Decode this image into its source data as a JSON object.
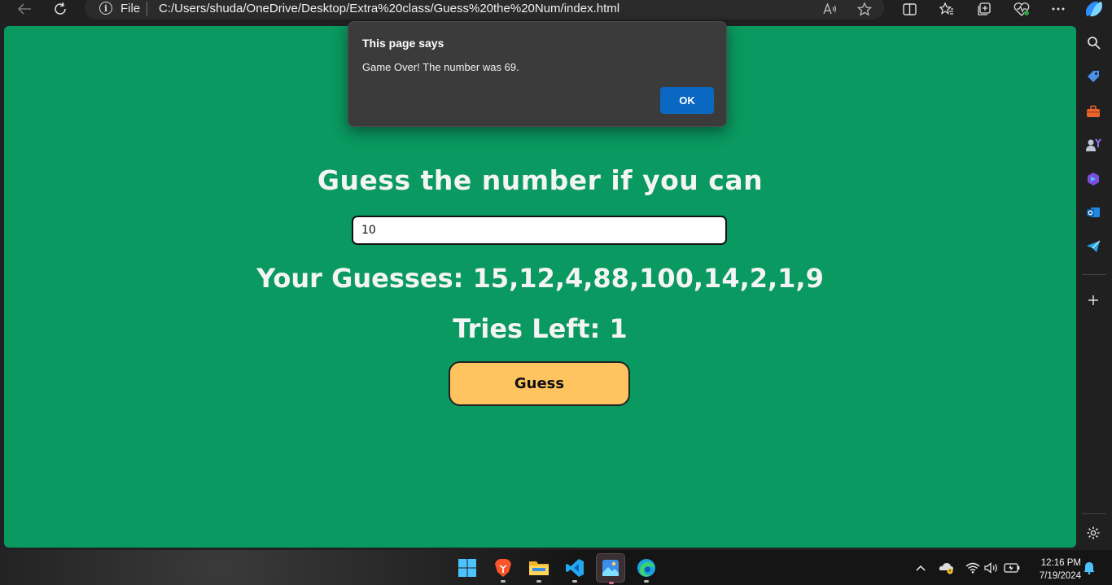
{
  "browser": {
    "address_prefix": "File",
    "url": "C:/Users/shuda/OneDrive/Desktop/Extra%20class/Guess%20the%20Num/index.html",
    "info_glyph": "i"
  },
  "game": {
    "heading": "Guess the number if you can",
    "input_value": "10",
    "guesses_text": "Your Guesses: 15,12,4,88,100,14,2,1,9",
    "tries_text": "Tries Left: 1",
    "button_label": "Guess"
  },
  "dialog": {
    "title": "This page says",
    "message": "Game Over! The number was 69.",
    "ok_label": "OK"
  },
  "taskbar": {
    "time": "12:16 PM",
    "date": "7/19/2024",
    "apps": [
      "windows-start",
      "brave",
      "file-explorer",
      "vscode",
      "photos",
      "edge"
    ]
  },
  "colors": {
    "page_bg": "#0a9960",
    "button_bg": "#ffc45f",
    "dialog_ok": "#0a67c2"
  }
}
